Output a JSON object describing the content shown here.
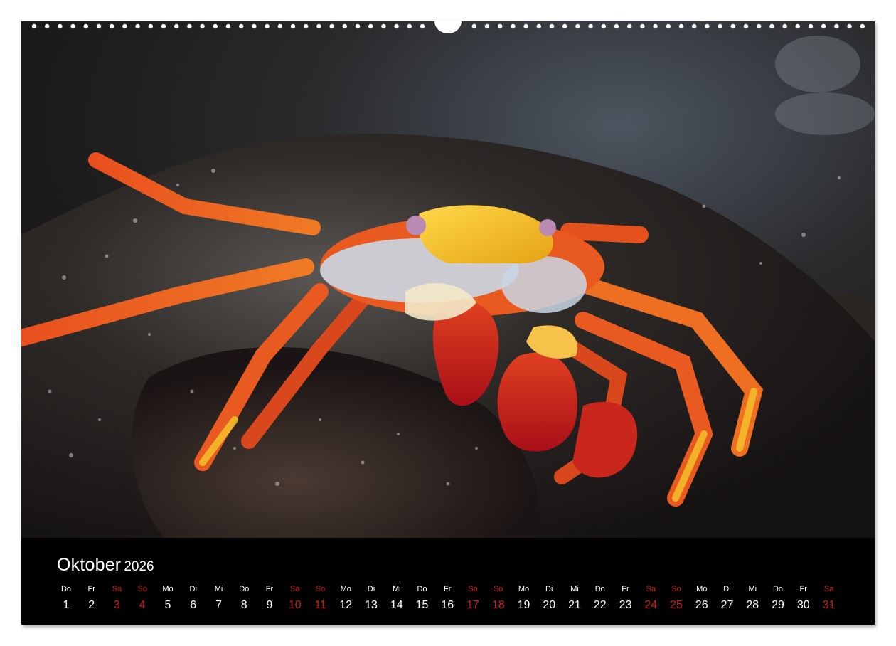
{
  "calendar": {
    "month": "Oktober",
    "year": "2026",
    "days": [
      {
        "dow": "Do",
        "num": "1",
        "weekend": false
      },
      {
        "dow": "Fr",
        "num": "2",
        "weekend": false
      },
      {
        "dow": "Sa",
        "num": "3",
        "weekend": true
      },
      {
        "dow": "So",
        "num": "4",
        "weekend": true
      },
      {
        "dow": "Mo",
        "num": "5",
        "weekend": false
      },
      {
        "dow": "Di",
        "num": "6",
        "weekend": false
      },
      {
        "dow": "Mi",
        "num": "7",
        "weekend": false
      },
      {
        "dow": "Do",
        "num": "8",
        "weekend": false
      },
      {
        "dow": "Fr",
        "num": "9",
        "weekend": false
      },
      {
        "dow": "Sa",
        "num": "10",
        "weekend": true
      },
      {
        "dow": "So",
        "num": "11",
        "weekend": true
      },
      {
        "dow": "Mo",
        "num": "12",
        "weekend": false
      },
      {
        "dow": "Di",
        "num": "13",
        "weekend": false
      },
      {
        "dow": "Mi",
        "num": "14",
        "weekend": false
      },
      {
        "dow": "Do",
        "num": "15",
        "weekend": false
      },
      {
        "dow": "Fr",
        "num": "16",
        "weekend": false
      },
      {
        "dow": "Sa",
        "num": "17",
        "weekend": true
      },
      {
        "dow": "So",
        "num": "18",
        "weekend": true
      },
      {
        "dow": "Mo",
        "num": "19",
        "weekend": false
      },
      {
        "dow": "Di",
        "num": "20",
        "weekend": false
      },
      {
        "dow": "Mi",
        "num": "21",
        "weekend": false
      },
      {
        "dow": "Do",
        "num": "22",
        "weekend": false
      },
      {
        "dow": "Fr",
        "num": "23",
        "weekend": false
      },
      {
        "dow": "Sa",
        "num": "24",
        "weekend": true
      },
      {
        "dow": "So",
        "num": "25",
        "weekend": true
      },
      {
        "dow": "Mo",
        "num": "26",
        "weekend": false
      },
      {
        "dow": "Di",
        "num": "27",
        "weekend": false
      },
      {
        "dow": "Mi",
        "num": "28",
        "weekend": false
      },
      {
        "dow": "Do",
        "num": "29",
        "weekend": false
      },
      {
        "dow": "Fr",
        "num": "30",
        "weekend": false
      },
      {
        "dow": "Sa",
        "num": "31",
        "weekend": true
      }
    ]
  },
  "colors": {
    "weekend": "#d11a1a",
    "weekday": "#ffffff",
    "band_background": "#000000",
    "crab_orange": "#e2571e",
    "crab_yellow": "#f2c21b",
    "crab_red": "#b8141c"
  }
}
